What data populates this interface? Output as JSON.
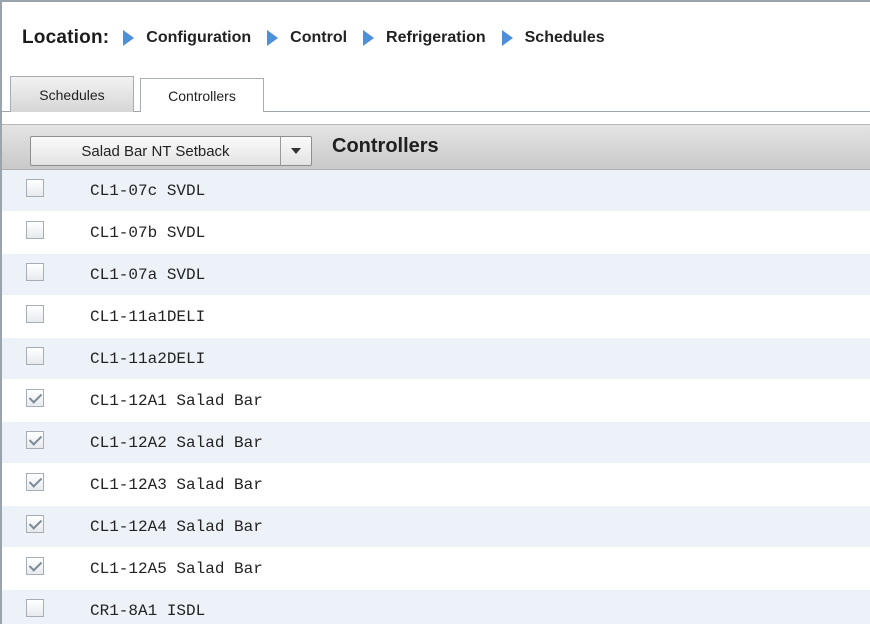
{
  "breadcrumb": {
    "label": "Location:",
    "items": [
      "Configuration",
      "Control",
      "Refrigeration",
      "Schedules"
    ]
  },
  "tabs": [
    {
      "label": "Schedules",
      "active": false
    },
    {
      "label": "Controllers",
      "active": true
    }
  ],
  "toolbar": {
    "dropdown_value": "Salad Bar NT Setback",
    "title": "Controllers"
  },
  "controllers": [
    {
      "label": "CL1-07c SVDL",
      "checked": false
    },
    {
      "label": "CL1-07b SVDL",
      "checked": false
    },
    {
      "label": "CL1-07a SVDL",
      "checked": false
    },
    {
      "label": "CL1-11a1DELI",
      "checked": false
    },
    {
      "label": "CL1-11a2DELI",
      "checked": false
    },
    {
      "label": "CL1-12A1 Salad Bar",
      "checked": true
    },
    {
      "label": "CL1-12A2 Salad Bar",
      "checked": true
    },
    {
      "label": "CL1-12A3 Salad Bar",
      "checked": true
    },
    {
      "label": "CL1-12A4 Salad Bar",
      "checked": true
    },
    {
      "label": "CL1-12A5 Salad Bar",
      "checked": true
    },
    {
      "label": "CR1-8A1 ISDL",
      "checked": false
    }
  ],
  "colors": {
    "breadcrumb_arrow": "#4d8fd8",
    "row_alt": "#edf2f8",
    "toolbar_bg": "#d6d6d6"
  }
}
